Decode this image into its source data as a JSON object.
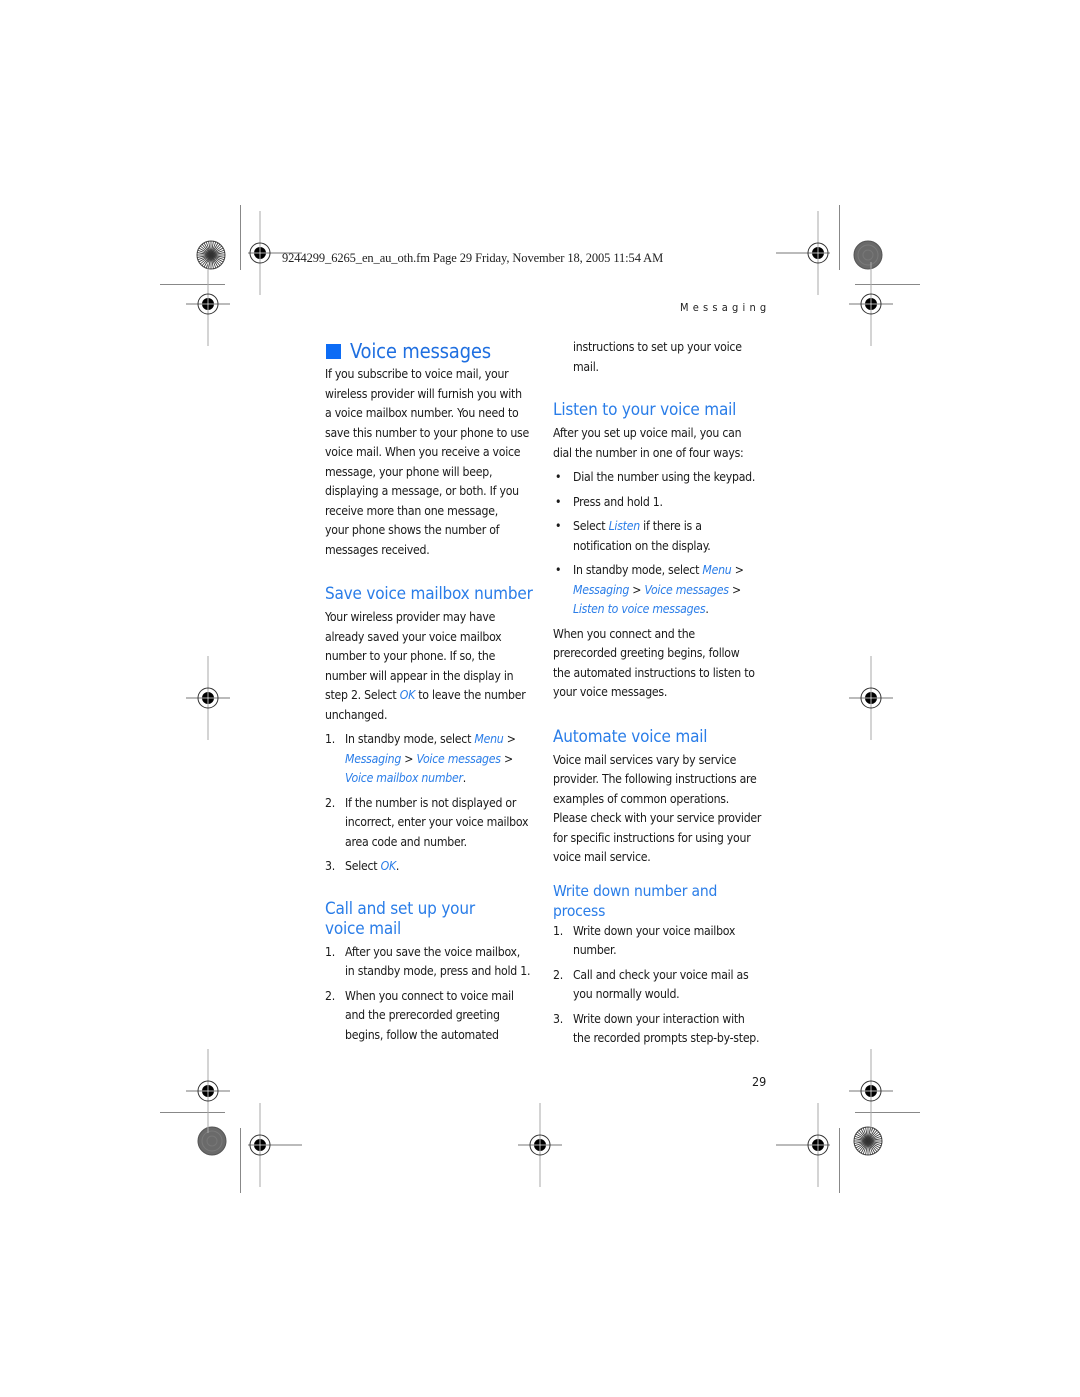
{
  "print_header": {
    "filename_line": "9244299_6265_en_au_oth.fm  Page 29  Friday, November 18, 2005  11:54 AM"
  },
  "running_head": "Messaging",
  "page_number": "29",
  "colors": {
    "heading_blue": "#2a7de8",
    "bullet_square": "#0d6cf5",
    "body_text": "#1a1a1a"
  },
  "left_column": {
    "main_heading": "Voice messages",
    "intro": "If you subscribe to voice mail, your wireless provider will furnish you with a voice mailbox number. You need to save this number to your phone to use voice mail. When you receive a voice message, your phone will beep, displaying a message, or both. If you receive more than one message, your phone shows the number of messages received.",
    "intro_lines": [
      "If you subscribe to voice mail, your",
      "wireless provider will furnish you with",
      "a voice mailbox number. You need to",
      "save this number to your phone to use",
      "voice mail. When you receive a voice",
      "message, your phone will beep,",
      "displaying a message, or both. If you",
      "receive more than one message,",
      "your phone shows the number of",
      "messages received."
    ],
    "save_section": {
      "heading": "Save voice mailbox number",
      "body_lines": [
        "Your wireless provider may have",
        "already saved your voice mailbox",
        "number to your phone. If so, the",
        "number will appear in the display in"
      ],
      "body_last_pre": "step 2. Select ",
      "body_last_link": "OK",
      "body_last_post": " to leave the number",
      "body_end": "unchanged.",
      "steps": [
        {
          "num": "1.",
          "pre": "In standby mode, select ",
          "link1": "Menu",
          "sep1": " >",
          "link2": "Messaging",
          "sep2": " > ",
          "link3": "Voice messages",
          "sep3": " >",
          "link4": "Voice mailbox number",
          "end": "."
        },
        {
          "num": "2.",
          "lines": [
            "If the number is not displayed or",
            "incorrect, enter your voice mailbox",
            "area code and number."
          ]
        },
        {
          "num": "3.",
          "pre": "Select ",
          "link": "OK",
          "end": "."
        }
      ]
    },
    "call_section": {
      "heading_line1": "Call and set up your",
      "heading_line2": "voice mail",
      "steps": [
        {
          "num": "1.",
          "lines": [
            "After you save the voice mailbox,",
            "in standby mode, press and hold 1."
          ]
        },
        {
          "num": "2.",
          "lines": [
            "When you connect to voice mail",
            "and the prerecorded greeting",
            "begins, follow the automated"
          ]
        }
      ]
    }
  },
  "right_column": {
    "continued_lines": [
      "instructions to set up your voice",
      "mail."
    ],
    "listen_section": {
      "heading": "Listen to your voice mail",
      "intro_lines": [
        "After you set up voice mail, you can",
        "dial the number in one of four ways:"
      ],
      "bullets": [
        {
          "text": "Dial the number using the keypad."
        },
        {
          "text": "Press and hold 1."
        },
        {
          "pre": "Select ",
          "link": "Listen",
          "post": " if there is a",
          "line2": "notification on the display."
        },
        {
          "pre": "In standby mode, select ",
          "link1": "Menu",
          "sep1": " >",
          "link2": "Messaging",
          "sep2": " > ",
          "link3": "Voice messages",
          "sep3": " >",
          "link4": "Listen to voice messages",
          "end": "."
        }
      ],
      "outro_lines": [
        "When you connect and the",
        "prerecorded greeting begins, follow",
        "the automated instructions to listen to",
        "your voice messages."
      ]
    },
    "automate_section": {
      "heading": "Automate voice mail",
      "body_lines": [
        "Voice mail services vary by service",
        "provider. The following instructions are",
        "examples of common operations.",
        "Please check with your service provider",
        "for specific instructions for using your",
        "voice mail service."
      ]
    },
    "write_section": {
      "heading_line1": "Write down number and",
      "heading_line2": "process",
      "steps": [
        {
          "num": "1.",
          "lines": [
            "Write down your voice mailbox",
            "number."
          ]
        },
        {
          "num": "2.",
          "lines": [
            "Call and check your voice mail as",
            "you normally would."
          ]
        },
        {
          "num": "3.",
          "lines": [
            "Write down your interaction with",
            "the recorded prompts step-by-step."
          ]
        }
      ]
    }
  },
  "icons": {
    "registration_mark": "crosshair-target",
    "color_wheel_starburst": "starburst-target",
    "gray_density_patch": "gray-dot-target",
    "section_square": "blue-square"
  }
}
